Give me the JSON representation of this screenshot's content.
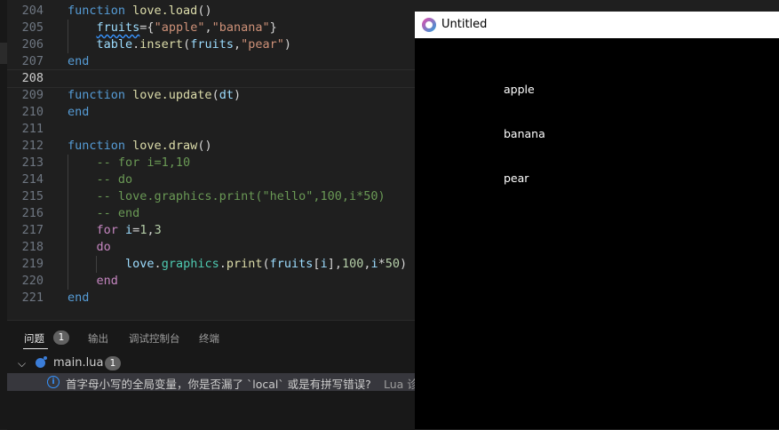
{
  "editor": {
    "lines": [
      {
        "no": "204",
        "parts": [
          [
            "kw2",
            "function "
          ],
          [
            "fn",
            "love.load"
          ],
          [
            "pl",
            "()"
          ]
        ]
      },
      {
        "no": "205",
        "parts": [
          [
            "pl",
            "    "
          ],
          [
            "id squig",
            "fruits"
          ],
          [
            "pl",
            "={"
          ],
          [
            "str",
            "\"apple\""
          ],
          [
            "pl",
            ","
          ],
          [
            "str",
            "\"banana\""
          ],
          [
            "pl",
            "}"
          ]
        ]
      },
      {
        "no": "206",
        "parts": [
          [
            "pl",
            "    "
          ],
          [
            "id",
            "table"
          ],
          [
            "pl",
            "."
          ],
          [
            "fn",
            "insert"
          ],
          [
            "pl",
            "("
          ],
          [
            "id",
            "fruits"
          ],
          [
            "pl",
            ","
          ],
          [
            "str",
            "\"pear\""
          ],
          [
            "pl",
            ")"
          ]
        ]
      },
      {
        "no": "207",
        "parts": [
          [
            "kw2",
            "end"
          ]
        ]
      },
      {
        "no": "208",
        "parts": [],
        "current": true
      },
      {
        "no": "209",
        "parts": [
          [
            "kw2",
            "function "
          ],
          [
            "fn",
            "love.update"
          ],
          [
            "pl",
            "("
          ],
          [
            "id",
            "dt"
          ],
          [
            "pl",
            ")"
          ]
        ]
      },
      {
        "no": "210",
        "parts": [
          [
            "kw2",
            "end"
          ]
        ]
      },
      {
        "no": "211",
        "parts": []
      },
      {
        "no": "212",
        "parts": [
          [
            "kw2",
            "function "
          ],
          [
            "fn",
            "love.draw"
          ],
          [
            "pl",
            "()"
          ]
        ]
      },
      {
        "no": "213",
        "parts": [
          [
            "pl",
            "    "
          ],
          [
            "cm",
            "-- for i=1,10"
          ]
        ]
      },
      {
        "no": "214",
        "parts": [
          [
            "pl",
            "    "
          ],
          [
            "cm",
            "-- do"
          ]
        ]
      },
      {
        "no": "215",
        "parts": [
          [
            "pl",
            "    "
          ],
          [
            "cm",
            "-- love.graphics.print(\"hello\",100,i*50)"
          ]
        ]
      },
      {
        "no": "216",
        "parts": [
          [
            "pl",
            "    "
          ],
          [
            "cm",
            "-- end"
          ]
        ]
      },
      {
        "no": "217",
        "parts": [
          [
            "pl",
            "    "
          ],
          [
            "kw",
            "for "
          ],
          [
            "id",
            "i"
          ],
          [
            "pl",
            "="
          ],
          [
            "num",
            "1"
          ],
          [
            "pl",
            ","
          ],
          [
            "num",
            "3"
          ]
        ]
      },
      {
        "no": "218",
        "parts": [
          [
            "pl",
            "    "
          ],
          [
            "kw",
            "do"
          ]
        ]
      },
      {
        "no": "219",
        "parts": [
          [
            "pl",
            "        "
          ],
          [
            "id",
            "love"
          ],
          [
            "pl",
            "."
          ],
          [
            "lib",
            "graphics"
          ],
          [
            "pl",
            "."
          ],
          [
            "fn",
            "print"
          ],
          [
            "pl",
            "("
          ],
          [
            "id",
            "fruits"
          ],
          [
            "pl",
            "["
          ],
          [
            "id",
            "i"
          ],
          [
            "pl",
            "],"
          ],
          [
            "num",
            "100"
          ],
          [
            "pl",
            ","
          ],
          [
            "id",
            "i"
          ],
          [
            "pl",
            "*"
          ],
          [
            "num",
            "50"
          ],
          [
            "pl",
            ")"
          ]
        ]
      },
      {
        "no": "220",
        "parts": [
          [
            "pl",
            "    "
          ],
          [
            "kw",
            "end"
          ]
        ]
      },
      {
        "no": "221",
        "parts": [
          [
            "kw2",
            "end"
          ]
        ]
      }
    ]
  },
  "panel": {
    "tabs": [
      "问题",
      "输出",
      "调试控制台",
      "终端"
    ],
    "problem_count": "1",
    "file": {
      "name": "main.lua",
      "count": "1"
    },
    "message": "首字母小写的全局变量，你是否漏了 `local` 或是有拼写错误?",
    "message_source": "Lua 诊"
  },
  "game_window": {
    "title": "Untitled",
    "fruits": [
      "apple",
      "banana",
      "pear"
    ]
  },
  "colors": {
    "editor_bg": "#1f1f1f",
    "window_bg": "#000000",
    "accent": "#3794ff"
  }
}
